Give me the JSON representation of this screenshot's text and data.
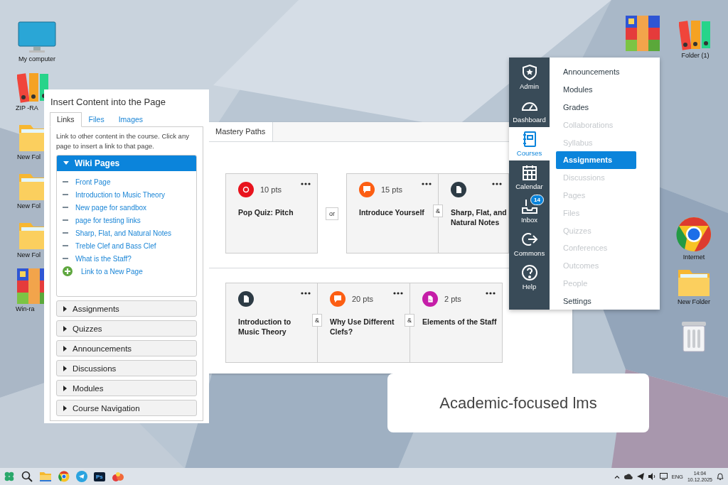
{
  "desktop_icons": [
    {
      "kind": "computer",
      "label": "My computer"
    },
    {
      "kind": "binders",
      "label": "ZIP -RA"
    },
    {
      "kind": "folder",
      "label": "New Fol"
    },
    {
      "kind": "folder",
      "label": "New Fol"
    },
    {
      "kind": "folder",
      "label": "New Fol"
    },
    {
      "kind": "archive",
      "label": "Win-ra"
    },
    {
      "kind": "archive"
    },
    {
      "kind": "binders",
      "label": "Folder (1)"
    },
    {
      "kind": "chrome",
      "label": "Internet"
    },
    {
      "kind": "folder",
      "label": "New Folder"
    },
    {
      "kind": "trash"
    }
  ],
  "insert_panel": {
    "title": "Insert Content into the Page",
    "tabs": [
      {
        "label": "Links",
        "selected": true
      },
      {
        "label": "Files",
        "selected": false
      },
      {
        "label": "Images",
        "selected": false
      }
    ],
    "description": "Link to other content in the course. Click any page to insert a link to that page.",
    "sections": [
      {
        "label": "Wiki Pages",
        "expanded": true,
        "pages": [
          "Front Page",
          "Introduction to Music Theory",
          "New page for sandbox",
          "page for testing links",
          "Sharp, Flat, and Natural Notes",
          "Treble Clef and Bass Clef",
          "What is the Staff?"
        ],
        "new_link": "Link to a New Page"
      },
      {
        "label": "Assignments",
        "expanded": false
      },
      {
        "label": "Quizzes",
        "expanded": false
      },
      {
        "label": "Announcements",
        "expanded": false
      },
      {
        "label": "Discussions",
        "expanded": false
      },
      {
        "label": "Modules",
        "expanded": false
      },
      {
        "label": "Course Navigation",
        "expanded": false
      }
    ]
  },
  "mastery_paths": {
    "tab": "Mastery Paths",
    "rows": [
      {
        "cards": [
          {
            "kind": "quiz",
            "color": "#e8141e",
            "points": "10 pts",
            "title": "Pop Quiz: Pitch"
          },
          {
            "kind": "discussion",
            "color": "#fc5e13",
            "points": "15 pts",
            "title": "Introduce Yourself",
            "join": {
              "kind": "or",
              "label": "or"
            }
          },
          {
            "kind": "page",
            "color": "#2d3b45",
            "title": "Sharp, Flat, and Natural Notes",
            "join": {
              "kind": "and",
              "label": "&"
            }
          }
        ]
      },
      {
        "cards": [
          {
            "kind": "page",
            "color": "#2d3b45",
            "title": "Introduction to Music Theory"
          },
          {
            "kind": "discussion",
            "color": "#fc5e13",
            "points": "20 pts",
            "title": "Why Use Different Clefs?",
            "join": {
              "kind": "and",
              "label": "&"
            }
          },
          {
            "kind": "assignment",
            "color": "#c51ea8",
            "points": "2 pts",
            "title": "Elements of the Staff",
            "join": {
              "kind": "and",
              "label": "&"
            }
          }
        ]
      }
    ]
  },
  "global_nav": [
    {
      "kind": "admin",
      "label": "Admin",
      "selected": false
    },
    {
      "kind": "dashboard",
      "label": "Dashboard",
      "selected": false
    },
    {
      "kind": "courses",
      "label": "Courses",
      "selected": true
    },
    {
      "kind": "calendar",
      "label": "Calendar",
      "selected": false
    },
    {
      "kind": "inbox",
      "label": "Inbox",
      "selected": false,
      "badge": "14"
    },
    {
      "kind": "commons",
      "label": "Commons",
      "selected": false
    },
    {
      "kind": "help",
      "label": "Help",
      "selected": false
    }
  ],
  "course_menu": [
    {
      "label": "Announcements",
      "selected": false,
      "disabled": false
    },
    {
      "label": "Modules",
      "selected": false,
      "disabled": false
    },
    {
      "label": "Grades",
      "selected": false,
      "disabled": false
    },
    {
      "label": "Collaborations",
      "selected": false,
      "disabled": true
    },
    {
      "label": "Syllabus",
      "selected": false,
      "disabled": true
    },
    {
      "label": "Assignments",
      "selected": true,
      "disabled": false
    },
    {
      "label": "Discussions",
      "selected": false,
      "disabled": true
    },
    {
      "label": "Pages",
      "selected": false,
      "disabled": true
    },
    {
      "label": "Files",
      "selected": false,
      "disabled": true
    },
    {
      "label": "Quizzes",
      "selected": false,
      "disabled": true
    },
    {
      "label": "Conferences",
      "selected": false,
      "disabled": true
    },
    {
      "label": "Outcomes",
      "selected": false,
      "disabled": true
    },
    {
      "label": "People",
      "selected": false,
      "disabled": true
    },
    {
      "label": "Settings",
      "selected": false,
      "disabled": false
    }
  ],
  "caption": "Academic-focused lms",
  "taskbar": {
    "apps": [
      {
        "kind": "start"
      },
      {
        "kind": "search"
      },
      {
        "kind": "files"
      },
      {
        "kind": "chrome"
      },
      {
        "kind": "telegram"
      },
      {
        "kind": "ps",
        "label": "Ps"
      },
      {
        "kind": "app"
      }
    ],
    "tray": {
      "language": "ENG",
      "time": "14:04",
      "date": "10.12.2025"
    }
  }
}
